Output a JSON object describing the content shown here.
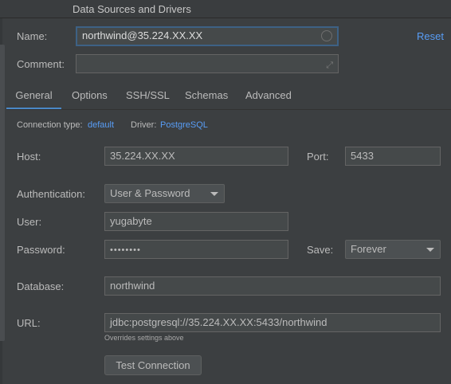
{
  "window": {
    "title": "Data Sources and Drivers"
  },
  "form": {
    "name_label": "Name:",
    "name_value": "northwind@35.224.XX.XX",
    "reset_label": "Reset",
    "comment_label": "Comment:",
    "comment_value": ""
  },
  "tabs": [
    {
      "label": "General",
      "active": true
    },
    {
      "label": "Options"
    },
    {
      "label": "SSH/SSL"
    },
    {
      "label": "Schemas"
    },
    {
      "label": "Advanced"
    }
  ],
  "general": {
    "connection_type_label": "Connection type:",
    "connection_type_value": "default",
    "driver_label": "Driver:",
    "driver_value": "PostgreSQL",
    "host_label": "Host:",
    "host_value": "35.224.XX.XX",
    "port_label": "Port:",
    "port_value": "5433",
    "auth_label": "Authentication:",
    "auth_value": "User & Password",
    "user_label": "User:",
    "user_value": "yugabyte",
    "password_label": "Password:",
    "password_value": "••••••••",
    "save_label": "Save:",
    "save_value": "Forever",
    "database_label": "Database:",
    "database_value": "northwind",
    "url_label": "URL:",
    "url_value": "jdbc:postgresql://35.224.XX.XX:5433/northwind",
    "url_hint": "Overrides settings above",
    "test_button": "Test Connection"
  },
  "colors": {
    "accent": "#589df6",
    "tab_underline": "#4a88c7",
    "background": "#3c3f41"
  }
}
